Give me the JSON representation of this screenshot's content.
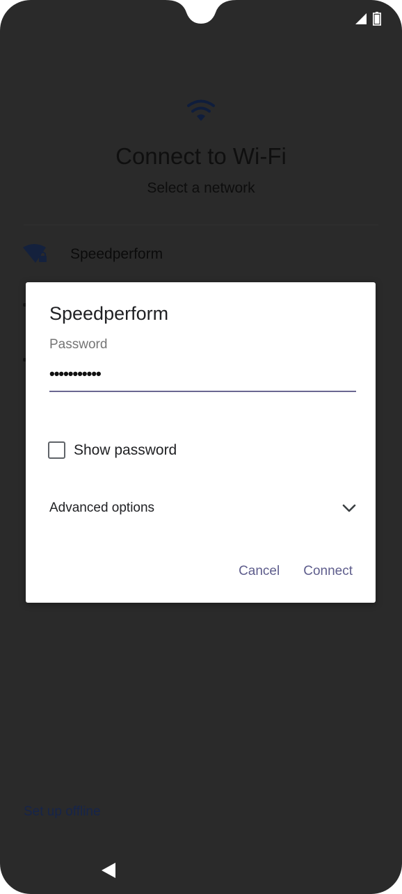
{
  "setup": {
    "title": "Connect to Wi-Fi",
    "subtitle": "Select a network",
    "networks": [
      {
        "name": "Speedperform",
        "icon": "wifi-lock-icon"
      }
    ],
    "offline_link": "Set up offline"
  },
  "dialog": {
    "title": "Speedperform",
    "password_label": "Password",
    "password_value": "•••••••••••",
    "show_password_label": "Show password",
    "show_password_checked": false,
    "advanced_label": "Advanced options",
    "cancel_label": "Cancel",
    "connect_label": "Connect"
  },
  "colors": {
    "accent": "#5e5d8c",
    "scrim": "#2a2a2a",
    "dialog_bg": "#ffffff"
  },
  "icons": {
    "status_signal": "signal-icon",
    "status_battery": "battery-icon",
    "hero": "wifi-icon",
    "advanced_toggle": "chevron-down-icon",
    "nav_back": "back-icon"
  }
}
